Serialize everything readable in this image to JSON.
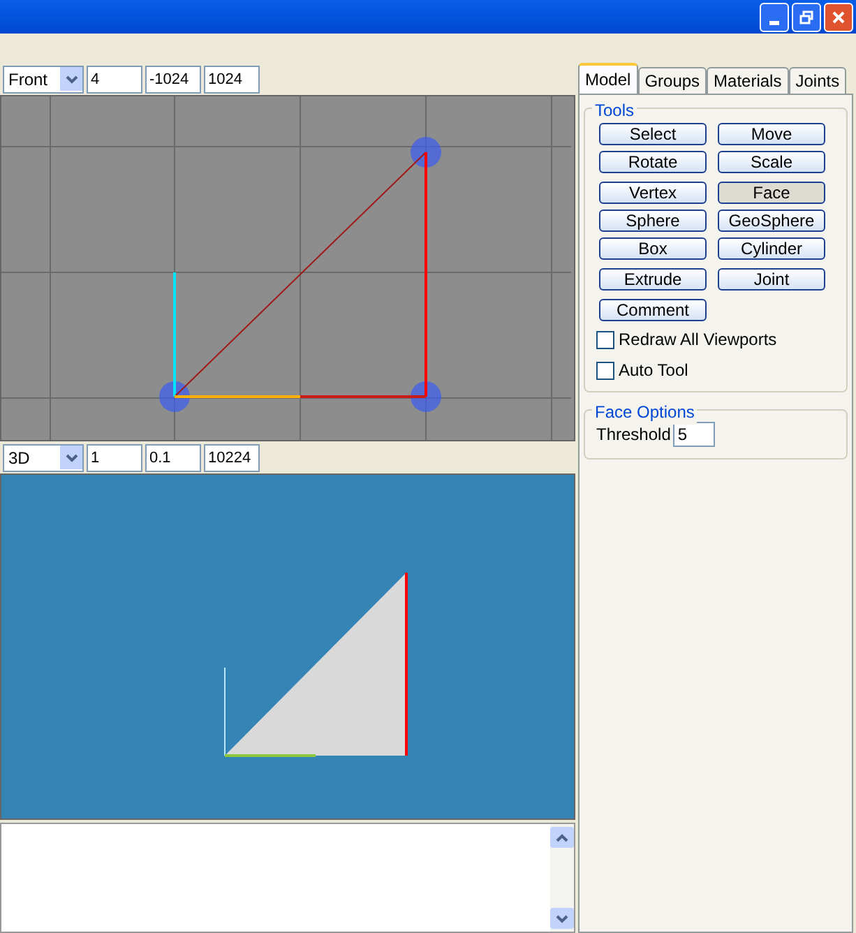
{
  "viewports": [
    {
      "view": "Front",
      "fields": [
        "4",
        "-1024",
        "1024"
      ],
      "kind": "ortho"
    },
    {
      "view": "3D",
      "fields": [
        "1",
        "0.1",
        "10224"
      ],
      "kind": "perspective"
    }
  ],
  "tabs": [
    {
      "label": "Model",
      "selected": true
    },
    {
      "label": "Groups",
      "selected": false
    },
    {
      "label": "Materials",
      "selected": false
    },
    {
      "label": "Joints",
      "selected": false
    }
  ],
  "tools": {
    "title": "Tools",
    "groups": [
      [
        {
          "label": "Select",
          "selected": false
        },
        {
          "label": "Move",
          "selected": false
        },
        {
          "label": "Rotate",
          "selected": false
        },
        {
          "label": "Scale",
          "selected": false
        }
      ],
      [
        {
          "label": "Vertex",
          "selected": false
        },
        {
          "label": "Face",
          "selected": true
        },
        {
          "label": "Sphere",
          "selected": false
        },
        {
          "label": "GeoSphere",
          "selected": false
        },
        {
          "label": "Box",
          "selected": false
        },
        {
          "label": "Cylinder",
          "selected": false
        }
      ],
      [
        {
          "label": "Extrude",
          "selected": false
        },
        {
          "label": "Joint",
          "selected": false
        }
      ],
      [
        {
          "label": "Comment",
          "selected": false
        }
      ]
    ],
    "checkboxes": [
      {
        "label": "Redraw All Viewports",
        "checked": false
      },
      {
        "label": "Auto Tool",
        "checked": false
      }
    ]
  },
  "face_options": {
    "title": "Face Options",
    "threshold_label": "Threshold",
    "threshold": "5"
  }
}
